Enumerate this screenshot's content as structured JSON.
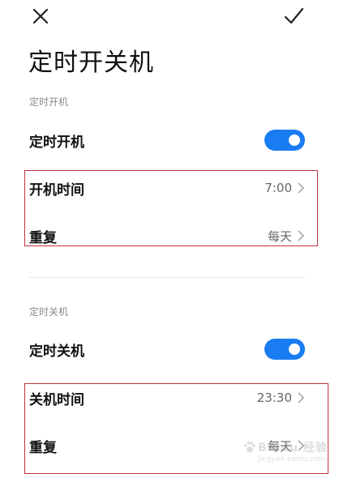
{
  "header": {
    "close_icon": "close-icon",
    "confirm_icon": "check-icon",
    "title": "定时开关机"
  },
  "accent_color": "#1a7cf3",
  "highlight_color": "#c0333a",
  "power_on": {
    "section_label": "定时开机",
    "toggle_label": "定时开机",
    "toggle_on": true,
    "time_label": "开机时间",
    "time_value": "7:00",
    "repeat_label": "重复",
    "repeat_value": "每天"
  },
  "power_off": {
    "section_label": "定时关机",
    "toggle_label": "定时关机",
    "toggle_on": true,
    "time_label": "关机时间",
    "time_value": "23:30",
    "repeat_label": "重复",
    "repeat_value": "每天"
  },
  "watermark": {
    "text": "Baidu 经验",
    "subtext": "jingyan.baidu.com"
  }
}
